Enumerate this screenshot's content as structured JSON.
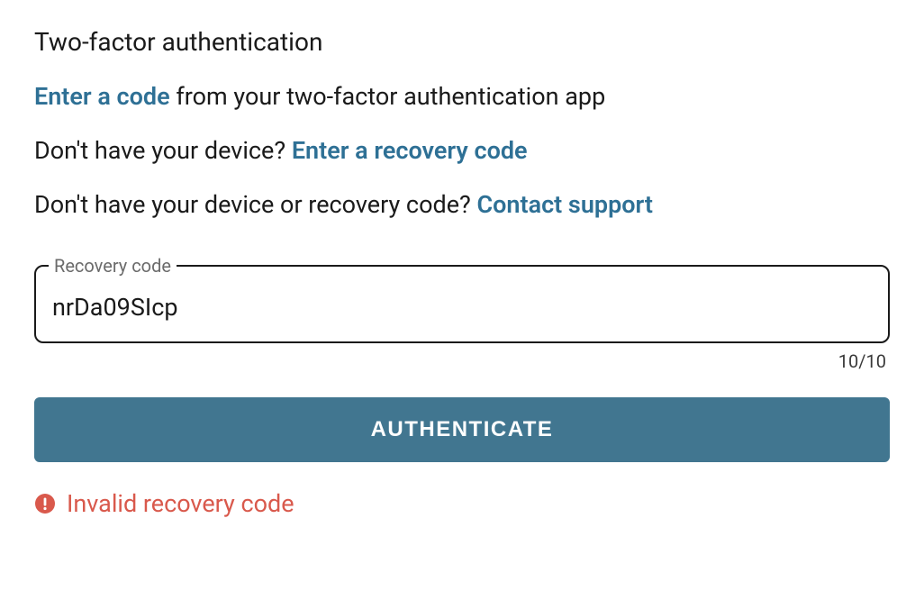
{
  "title": "Two-factor authentication",
  "lines": {
    "enter_code": {
      "link": "Enter a code",
      "rest": " from your two-factor authentication app"
    },
    "recovery": {
      "prefix": "Don't have your device? ",
      "link": "Enter a recovery code"
    },
    "support": {
      "prefix": "Don't have your device or recovery code? ",
      "link": "Contact support"
    }
  },
  "field": {
    "label": "Recovery code",
    "value": "nrDa09SIcp",
    "char_count": "10/10"
  },
  "button": {
    "label": "AUTHENTICATE"
  },
  "error": {
    "message": "Invalid recovery code"
  },
  "colors": {
    "link": "#2e7095",
    "button_bg": "#417690",
    "error": "#d9594c"
  }
}
